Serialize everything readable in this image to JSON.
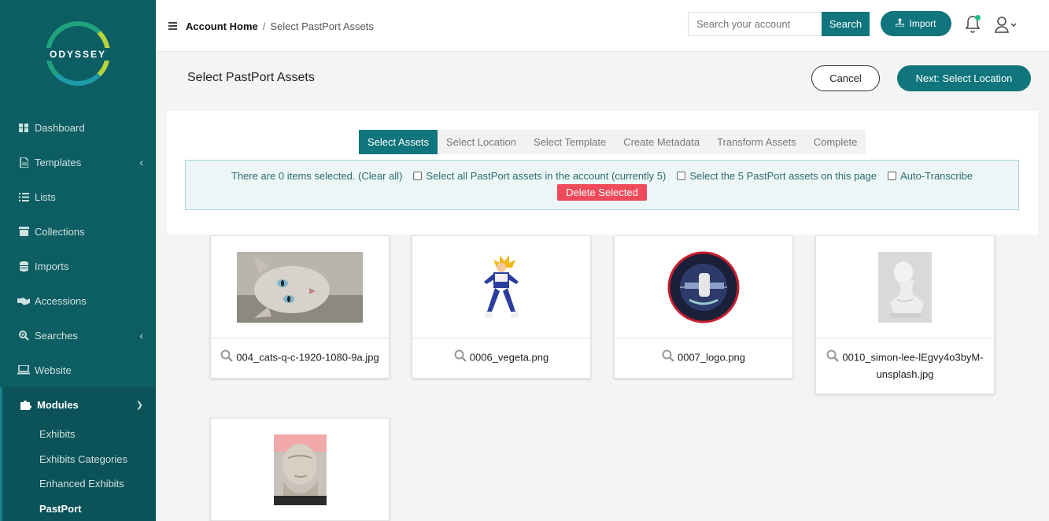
{
  "sidebar": {
    "logo_text": "ODYSSEY",
    "items": [
      {
        "label": "Dashboard",
        "icon": "dashboard-icon"
      },
      {
        "label": "Templates",
        "icon": "file-icon"
      },
      {
        "label": "Lists",
        "icon": "list-icon"
      },
      {
        "label": "Collections",
        "icon": "archive-icon"
      },
      {
        "label": "Imports",
        "icon": "database-icon"
      },
      {
        "label": "Accessions",
        "icon": "handshake-icon"
      },
      {
        "label": "Searches",
        "icon": "search-plus-icon"
      },
      {
        "label": "Website",
        "icon": "laptop-icon"
      }
    ],
    "modules_label": "Modules",
    "sub_items": [
      "Exhibits",
      "Exhibits Categories",
      "Enhanced Exhibits",
      "PastPort"
    ]
  },
  "header": {
    "breadcrumb_home": "Account Home",
    "breadcrumb_sep": "/",
    "breadcrumb_current": "Select PastPort Assets",
    "search_placeholder": "Search your account",
    "search_button": "Search",
    "import_button": "Import"
  },
  "page": {
    "title": "Select PastPort Assets",
    "cancel": "Cancel",
    "next": "Next: Select Location"
  },
  "steps": [
    "Select Assets",
    "Select Location",
    "Select Template",
    "Create Metadata",
    "Transform Assets",
    "Complete"
  ],
  "selection": {
    "status_text": "There are 0 items selected.",
    "clear_all": "(Clear all)",
    "select_all_account": "Select all PastPort assets in the account (currently 5)",
    "select_page": "Select the 5 PastPort assets on this page",
    "auto_transcribe": "Auto-Transcribe",
    "delete_selected": "Delete Selected"
  },
  "assets": [
    {
      "filename": "004_cats-q-c-1920-1080-9a.jpg"
    },
    {
      "filename": "0006_vegeta.png"
    },
    {
      "filename": "0007_logo.png"
    },
    {
      "filename": "0010_simon-lee-lEgvy4o3byM-unsplash.jpg"
    },
    {
      "filename": ""
    }
  ],
  "colors": {
    "sidebar": "#0d5e63",
    "accent": "#10757c",
    "danger": "#ef4a5a"
  }
}
